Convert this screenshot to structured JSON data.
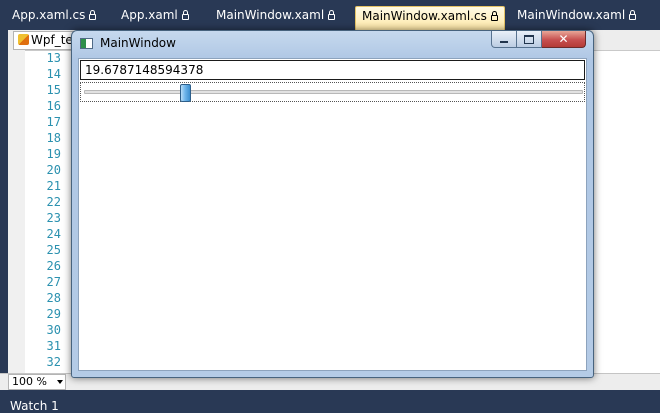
{
  "ide": {
    "tabs": [
      {
        "label": "App.xaml.cs",
        "locked": true,
        "active": false
      },
      {
        "label": "App.xaml",
        "locked": true,
        "active": false
      },
      {
        "label": "MainWindow.xaml",
        "locked": true,
        "active": false
      },
      {
        "label": "MainWindow.xaml.cs",
        "locked": true,
        "active": true
      },
      {
        "label": "MainWindow.xaml",
        "locked": true,
        "active": false
      }
    ],
    "editor": {
      "project_combo": "Wpf_te",
      "line_numbers": [
        "13",
        "14",
        "15",
        "16",
        "17",
        "18",
        "19",
        "20",
        "21",
        "22",
        "23",
        "24",
        "25",
        "26",
        "27",
        "28",
        "29",
        "30",
        "31",
        "32"
      ]
    },
    "zoom": "100 %",
    "bottom_panel": "Watch 1"
  },
  "wpf_window": {
    "title": "MainWindow",
    "textbox_value": "19.6787148594378",
    "slider": {
      "min": 0,
      "max": 100,
      "value": 19.6787148594378
    }
  }
}
